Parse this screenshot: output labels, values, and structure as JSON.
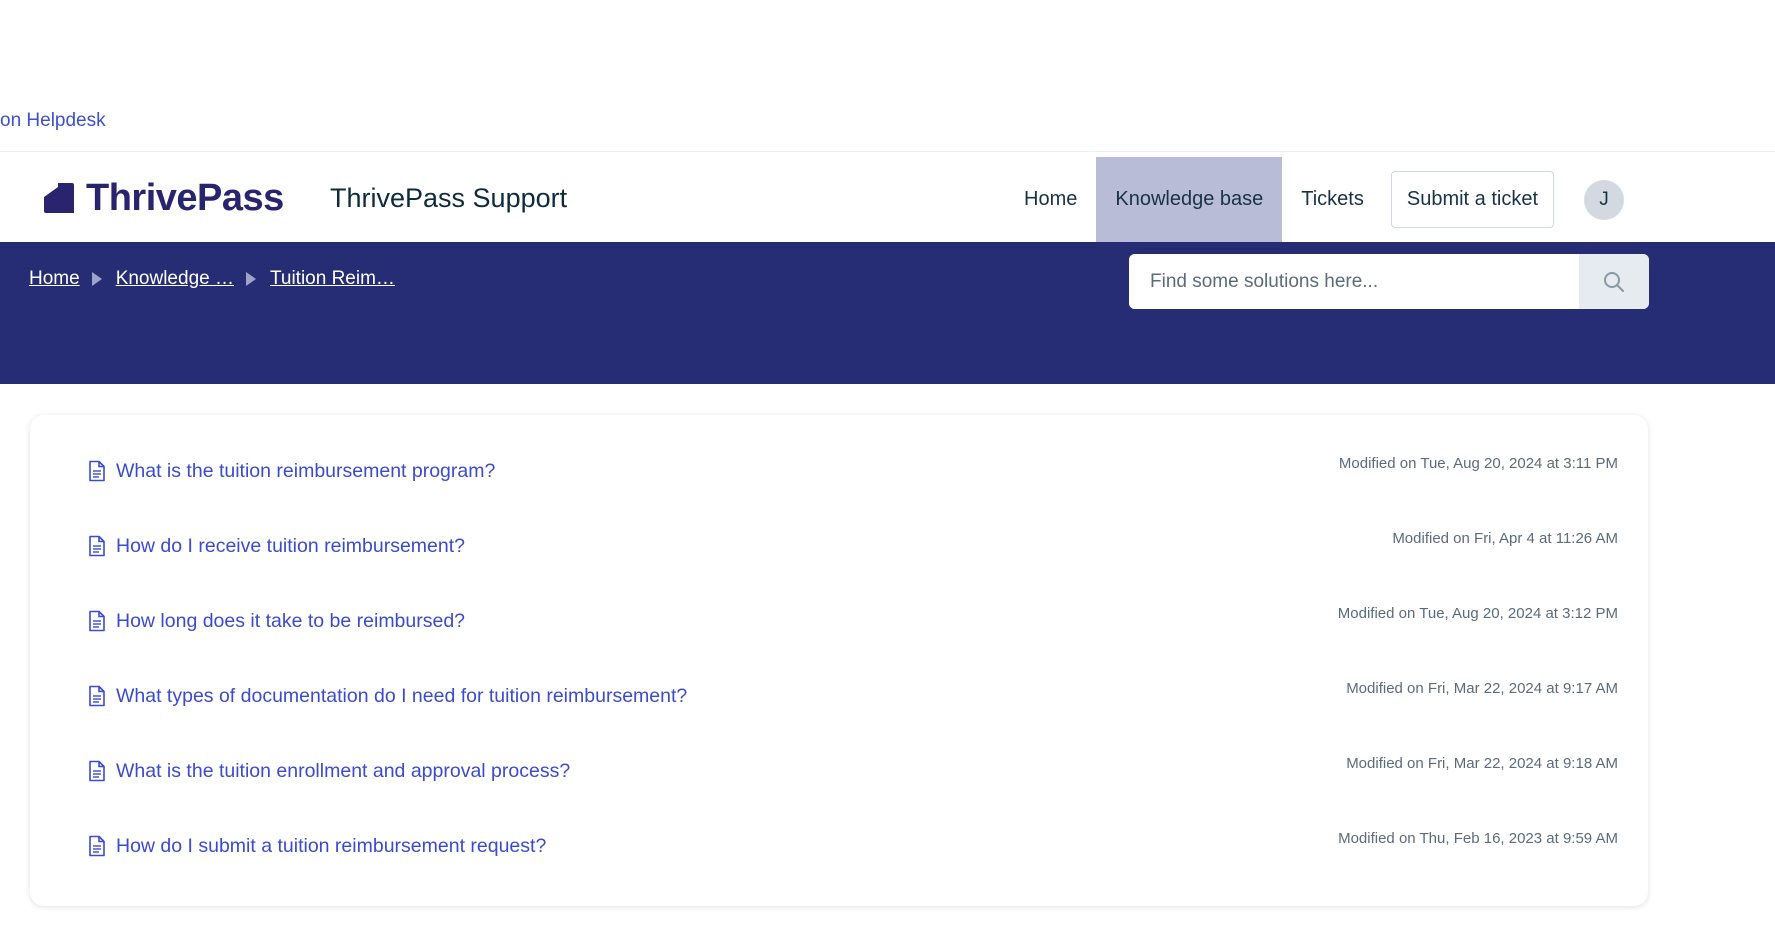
{
  "top_link": "on Helpdesk",
  "header": {
    "logo_text": "ThrivePass",
    "portal_name": "ThrivePass Support",
    "nav": [
      {
        "label": "Home"
      },
      {
        "label": "Knowledge base",
        "active": true
      },
      {
        "label": "Tickets"
      }
    ],
    "submit_label": "Submit a ticket",
    "avatar_initial": "J"
  },
  "breadcrumb": [
    "Home",
    "Knowledge …",
    "Tuition Reim…"
  ],
  "search": {
    "placeholder": "Find some solutions here..."
  },
  "articles": [
    {
      "title": "What is the tuition reimbursement program?",
      "modified": "Modified on Tue, Aug 20, 2024 at 3:11 PM"
    },
    {
      "title": "How do I receive tuition reimbursement?",
      "modified": "Modified on Fri, Apr 4 at 11:26 AM"
    },
    {
      "title": "How long does it take to be reimbursed?",
      "modified": "Modified on Tue, Aug 20, 2024 at 3:12 PM"
    },
    {
      "title": "What types of documentation do I need for tuition reimbursement?",
      "modified": "Modified on Fri, Mar 22, 2024 at 9:17 AM"
    },
    {
      "title": "What is the tuition enrollment and approval process?",
      "modified": "Modified on Fri, Mar 22, 2024 at 9:18 AM"
    },
    {
      "title": "How do I submit a tuition reimbursement request?",
      "modified": "Modified on Thu, Feb 16, 2023 at 9:59 AM"
    }
  ],
  "colors": {
    "banner": "#262d75",
    "link": "#3a4bcf",
    "nav_active_bg": "#b9bcd6",
    "logo": "#28256e"
  },
  "icons": {
    "article": "document-icon",
    "search": "search-icon",
    "breadcrumb_separator": "caret-right-icon"
  }
}
